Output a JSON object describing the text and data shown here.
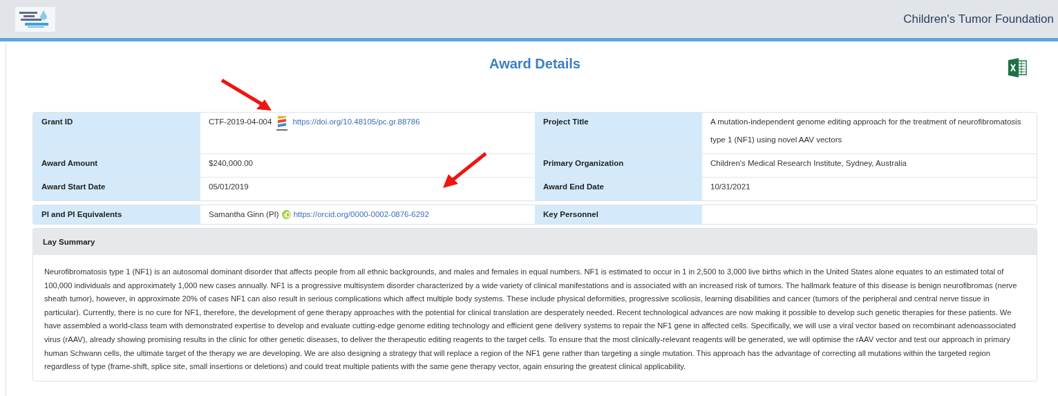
{
  "header": {
    "organization": "Children's Tumor Foundation"
  },
  "page": {
    "title": "Award Details"
  },
  "details": [
    {
      "label": "Grant ID",
      "value": "CTF-2019-04-004",
      "kind": "doi",
      "link": "https://doi.org/10.48105/pc.gr.88786",
      "label_2": "Project Title",
      "value_2": "A mutation-independent genome editing approach for the treatment of neurofibromatosis type 1 (NF1) using novel AAV vectors"
    },
    {
      "label": "Award Amount",
      "value": "$240,000.00",
      "kind": "plain",
      "label_2": "Primary Organization",
      "value_2": "Children's Medical Research Institute, Sydney, Australia"
    },
    {
      "label": "Award Start Date",
      "value": "05/01/2019",
      "kind": "plain",
      "label_2": "Award End Date",
      "value_2": "10/31/2021"
    }
  ],
  "personnel": {
    "label": "PI and PI Equivalents",
    "value": "Samantha Ginn (PI)",
    "kind": "orcid",
    "link": "https://orcid.org/0000-0002-0876-6292",
    "label_2": "Key Personnel"
  },
  "lay_summary": {
    "heading": "Lay Summary",
    "text": "Neurofibromatosis type 1 (NF1) is an autosomal dominant disorder that affects people from all ethnic backgrounds, and males and females in equal numbers. NF1 is estimated to occur in 1 in 2,500 to 3,000 live births which in the United States alone equates to an estimated total of 100,000 individuals and approximately 1,000 new cases annually. NF1 is a progressive multisystem disorder characterized by a wide variety of clinical manifestations and is associated with an increased risk of tumors. The hallmark feature of this disease is benign neurofibromas (nerve sheath tumor), however, in approximate 20% of cases NF1 can also result in serious complications which affect multiple body systems. These include physical deformities, progressive scoliosis, learning disabilities and cancer (tumors of the peripheral and central nerve tissue in particular). Currently, there is no cure for NF1, therefore, the development of gene therapy approaches with the potential for clinical translation are desperately needed. Recent technological advances are now making it possible to develop such genetic therapies for these patients. We have assembled a world-class team with demonstrated expertise to develop and evaluate cutting-edge genome editing technology and efficient gene delivery systems to repair the NF1 gene in affected cells. Specifically, we will use a viral vector based on recombinant adenoassociated virus (rAAV), already showing promising results in the clinic for other genetic diseases, to deliver the therapeutic editing reagents to the target cells. To ensure that the most clinically-relevant reagents will be generated, we will optimise the rAAV vector and test our approach in primary human Schwann cells, the ultimate target of the therapy we are developing. We are also designing a strategy that will replace a region of the NF1 gene rather than targeting a single mutation. This approach has the advantage of correcting all mutations within the targeted region regardless of type (frame-shift, splice site, small insertions or deletions) and could treat multiple patients with the same gene therapy vector, again ensuring the greatest clinical applicability."
  }
}
